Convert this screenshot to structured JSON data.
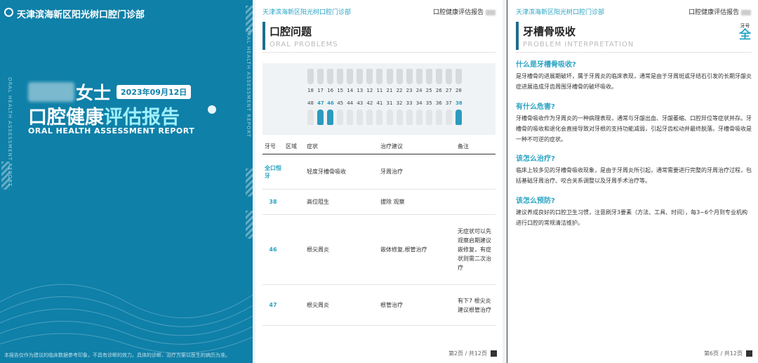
{
  "cover": {
    "clinic": "天津滨海新区阳光树口腔门诊部",
    "vertical_text": "ORAL HEALTH ASSESSMENT REPORT",
    "name_suffix": "女士",
    "date": "2023年09月12日",
    "title_white": "口腔健康",
    "title_light": "评估报告",
    "subtitle": "ORAL HEALTH ASSESSMENT REPORT",
    "disclaimer": "本报告仅作为建议的临床数据参考印象，不具有诊断的效力。具体的诊断、治疗方案以医生的病历为准。"
  },
  "page2": {
    "header_left": "天津滨海新区阳光树口腔门诊部",
    "header_right": "口腔健康评估报告",
    "title": "口腔问题",
    "title_en": "ORAL PROBLEMS",
    "upper_numbers": [
      "18",
      "17",
      "16",
      "15",
      "14",
      "13",
      "12",
      "11",
      "21",
      "22",
      "23",
      "24",
      "25",
      "26",
      "27",
      "28"
    ],
    "lower_numbers": [
      "48",
      "47",
      "46",
      "45",
      "44",
      "43",
      "42",
      "41",
      "31",
      "32",
      "33",
      "34",
      "35",
      "36",
      "37",
      "38"
    ],
    "highlight_lower": [
      "47",
      "46",
      "38"
    ],
    "table": {
      "headers": [
        "牙号",
        "区域",
        "症状",
        "治疗建议",
        "备注"
      ],
      "rows": [
        {
          "tooth": "全口恒牙",
          "area": "",
          "symptom": "轻度牙槽骨吸收",
          "treatment": "牙周治疗",
          "note": ""
        },
        {
          "tooth": "38",
          "area": "",
          "symptom": "高位阻生",
          "treatment": "拔除 观察",
          "note": ""
        },
        {
          "tooth": "46",
          "area": "",
          "symptom": "根尖周炎",
          "treatment": "嵌体修复,根管治疗",
          "note": "无症状可以先观察启期建议嵌修复，有症状则需二次治疗"
        },
        {
          "tooth": "47",
          "area": "",
          "symptom": "根尖周炎",
          "treatment": "根管治疗",
          "note": "有下7 根尖炎 建议根管治疗"
        }
      ]
    },
    "page_label": "第2页 / 共12页"
  },
  "page6": {
    "header_left": "天津滨海新区阳光树口腔门诊部",
    "header_right": "口腔健康评估报告",
    "title": "牙槽骨吸收",
    "title_en": "PROBLEM INTERPRETATION",
    "tag_small": "牙号",
    "tag_big": "全",
    "sections": [
      {
        "q": "什么是牙槽骨吸收?",
        "a": "是牙槽骨的进展期破坏，属于牙周炎的临床表现，通常是由于牙周斑或牙结石引发的长期牙龈炎症进展造成牙齿周围牙槽骨的破坏吸收。"
      },
      {
        "q": "有什么危害?",
        "a": "牙槽骨吸收作为牙周炎的一种病理表现，通常与牙龈出血、牙龈萎缩、口腔异位等症状并存。牙槽骨的吸收和退化会直接导致对牙根的支持功能减弱，引起牙齿松动并最终脱落。牙槽骨吸收是一种不可逆的症状。"
      },
      {
        "q": "该怎么治疗?",
        "a": "临床上较多见的牙槽骨吸收现象，是由于牙周炎所引起，通常需要进行完整的牙周治疗过程，包括基础牙周治疗、咬合关系调整以及牙周手术治疗等。"
      },
      {
        "q": "该怎么预防?",
        "a": "建议养成良好的口腔卫生习惯，注意刷牙3要素（方法、工具、时间），每3~6个月到专业机构进行口腔的常规清洁维护。"
      }
    ],
    "page_label": "第6页 / 共12页"
  }
}
